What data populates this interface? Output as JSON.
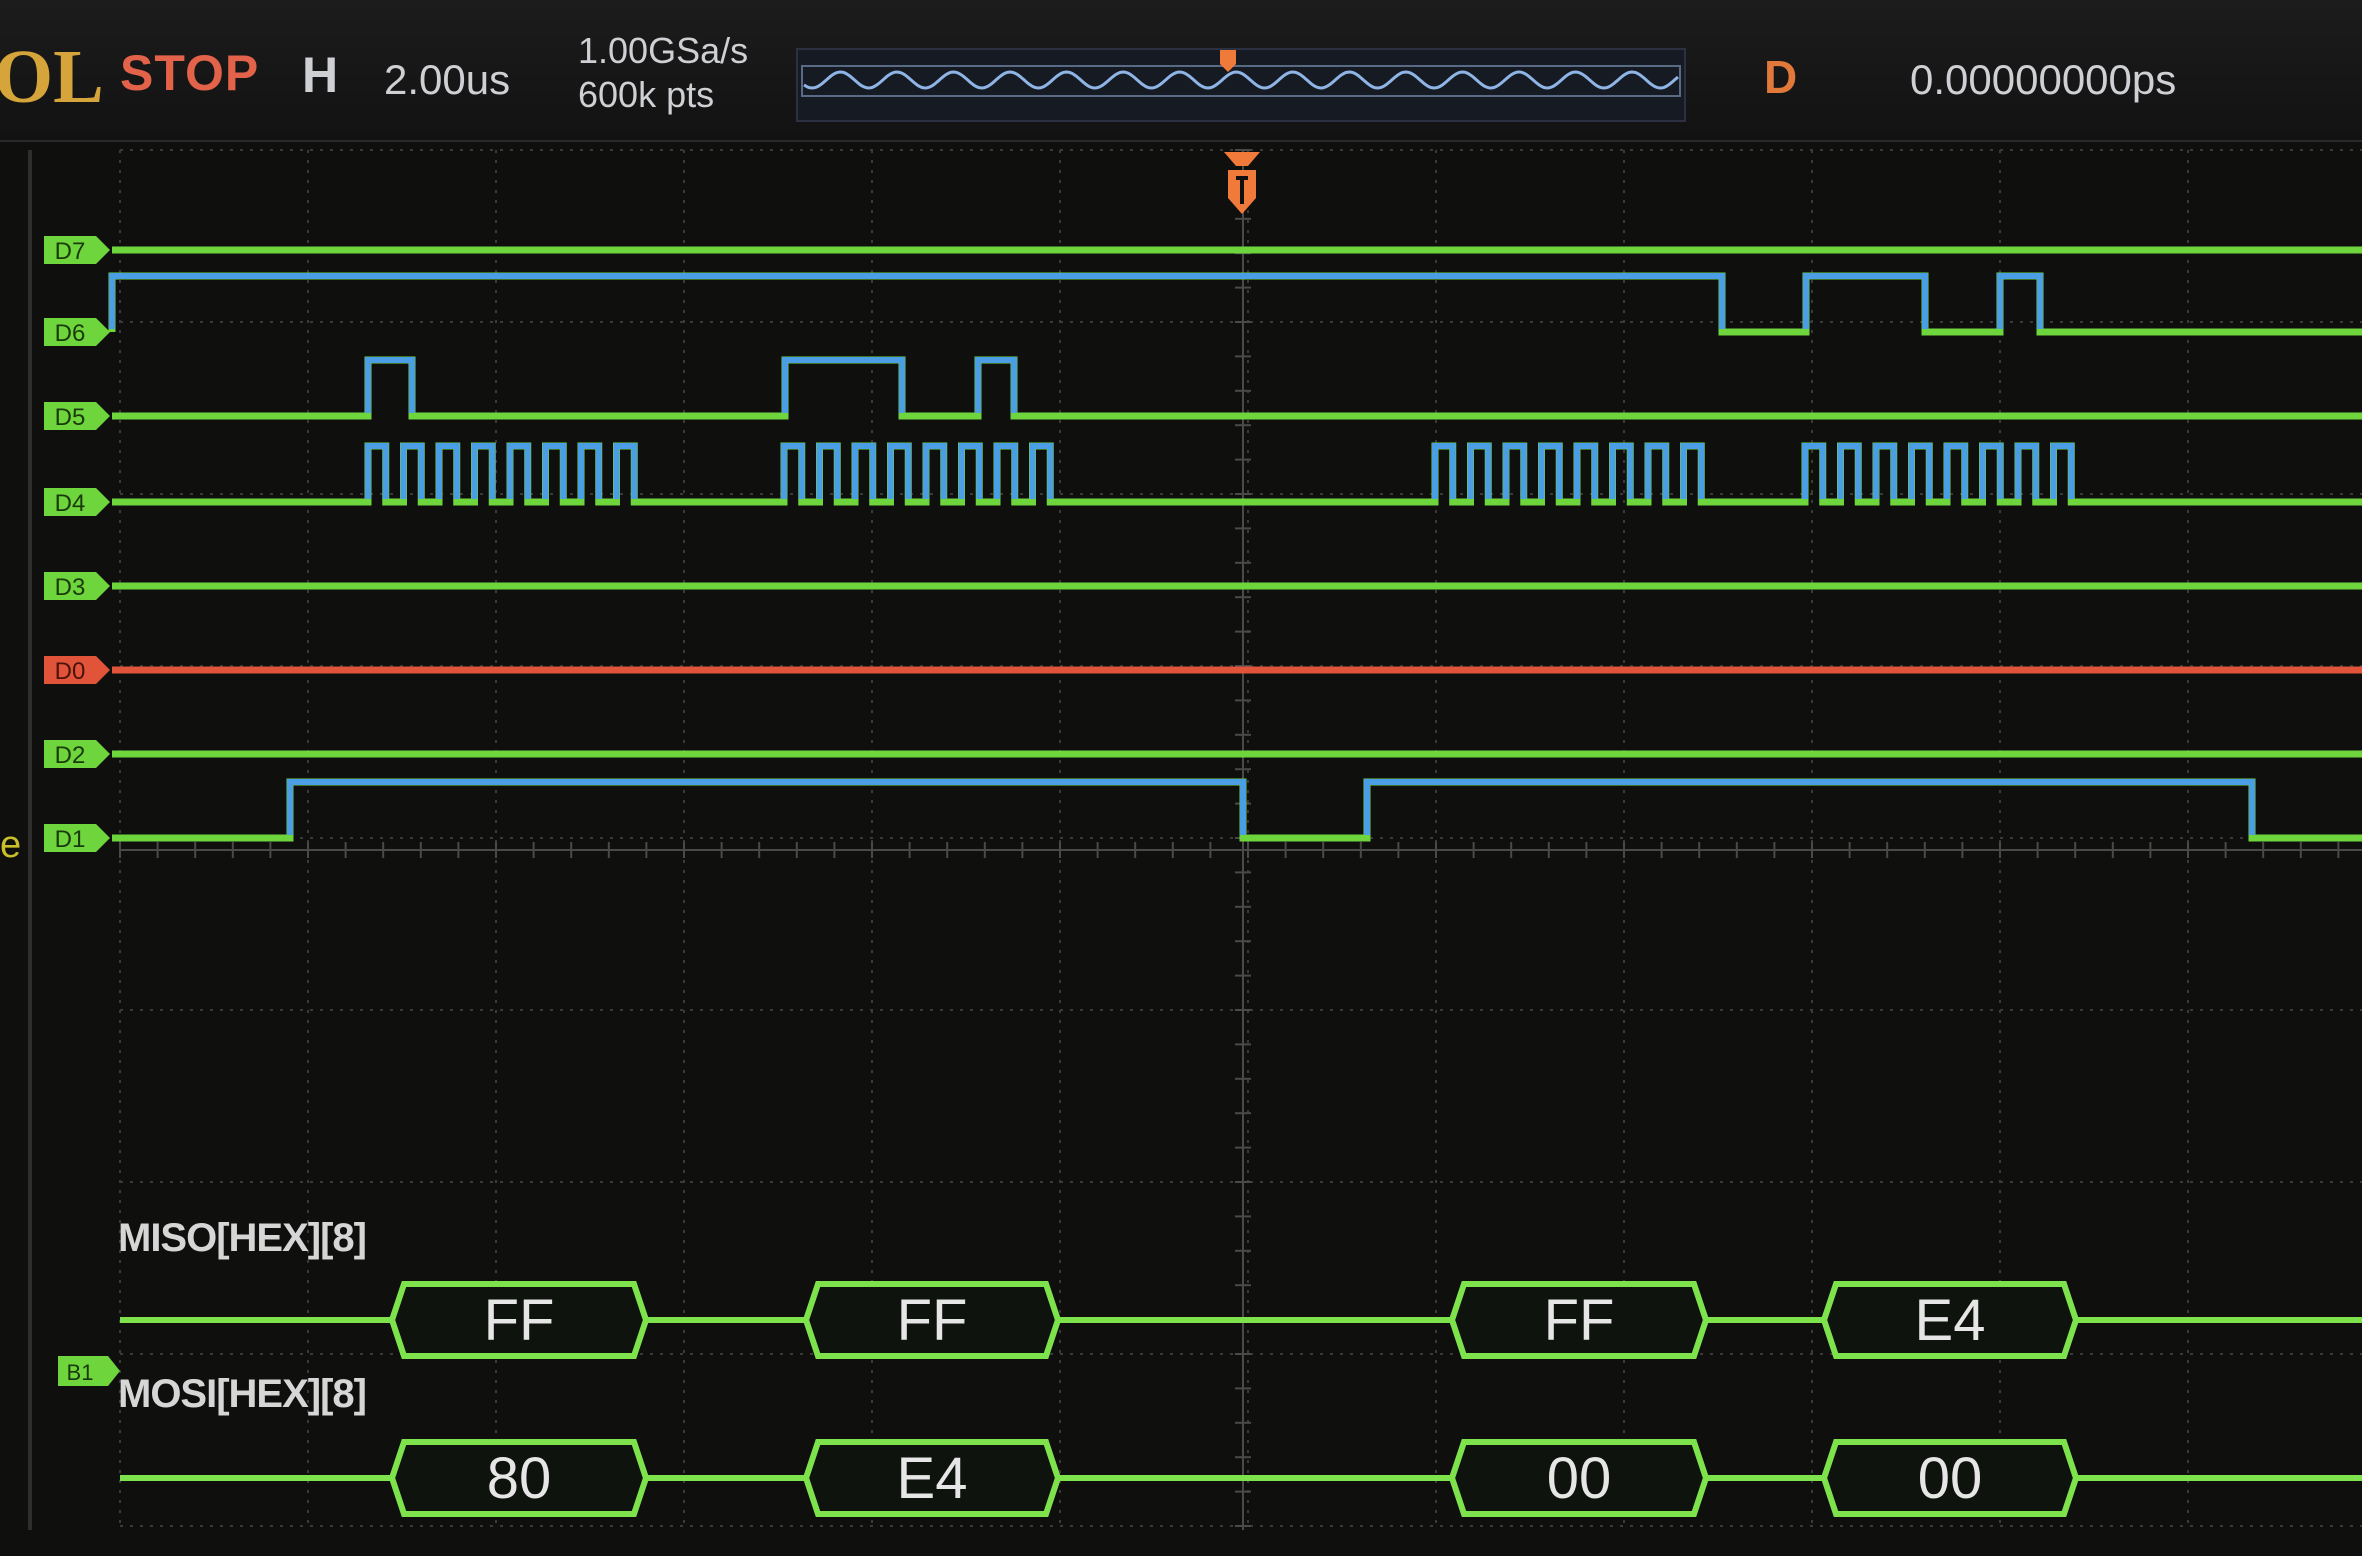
{
  "header": {
    "brand": "OL",
    "run_state": "STOP",
    "horizontal_label": "H",
    "timebase": "2.00us",
    "sample_rate": "1.00GSa/s",
    "memory_depth": "600k pts",
    "delay_label": "D",
    "delay_value": "0.00000000ps"
  },
  "channels": [
    {
      "label": "D7",
      "color": "#6fd53d"
    },
    {
      "label": "D6",
      "color": "#6fd53d"
    },
    {
      "label": "D5",
      "color": "#6fd53d"
    },
    {
      "label": "D4",
      "color": "#6fd53d"
    },
    {
      "label": "D3",
      "color": "#6fd53d"
    },
    {
      "label": "D0",
      "color": "#e2543a"
    },
    {
      "label": "D2",
      "color": "#6fd53d"
    },
    {
      "label": "D1",
      "color": "#6fd53d"
    }
  ],
  "bus_marker": "B1",
  "edge_char": "e",
  "decode": {
    "miso": {
      "label": "MISO[HEX][8]",
      "values": [
        "FF",
        "FF",
        "FF",
        "E4"
      ]
    },
    "mosi": {
      "label": "MOSI[HEX][8]",
      "values": [
        "80",
        "E4",
        "00",
        "00"
      ]
    }
  },
  "colors": {
    "high": "#4b9ee3",
    "low": "#6fd53d",
    "active_channel": "#e2543a",
    "trigger": "#f07a3a",
    "decode": "#7ee24d",
    "grid": "#3a3a3a"
  }
}
